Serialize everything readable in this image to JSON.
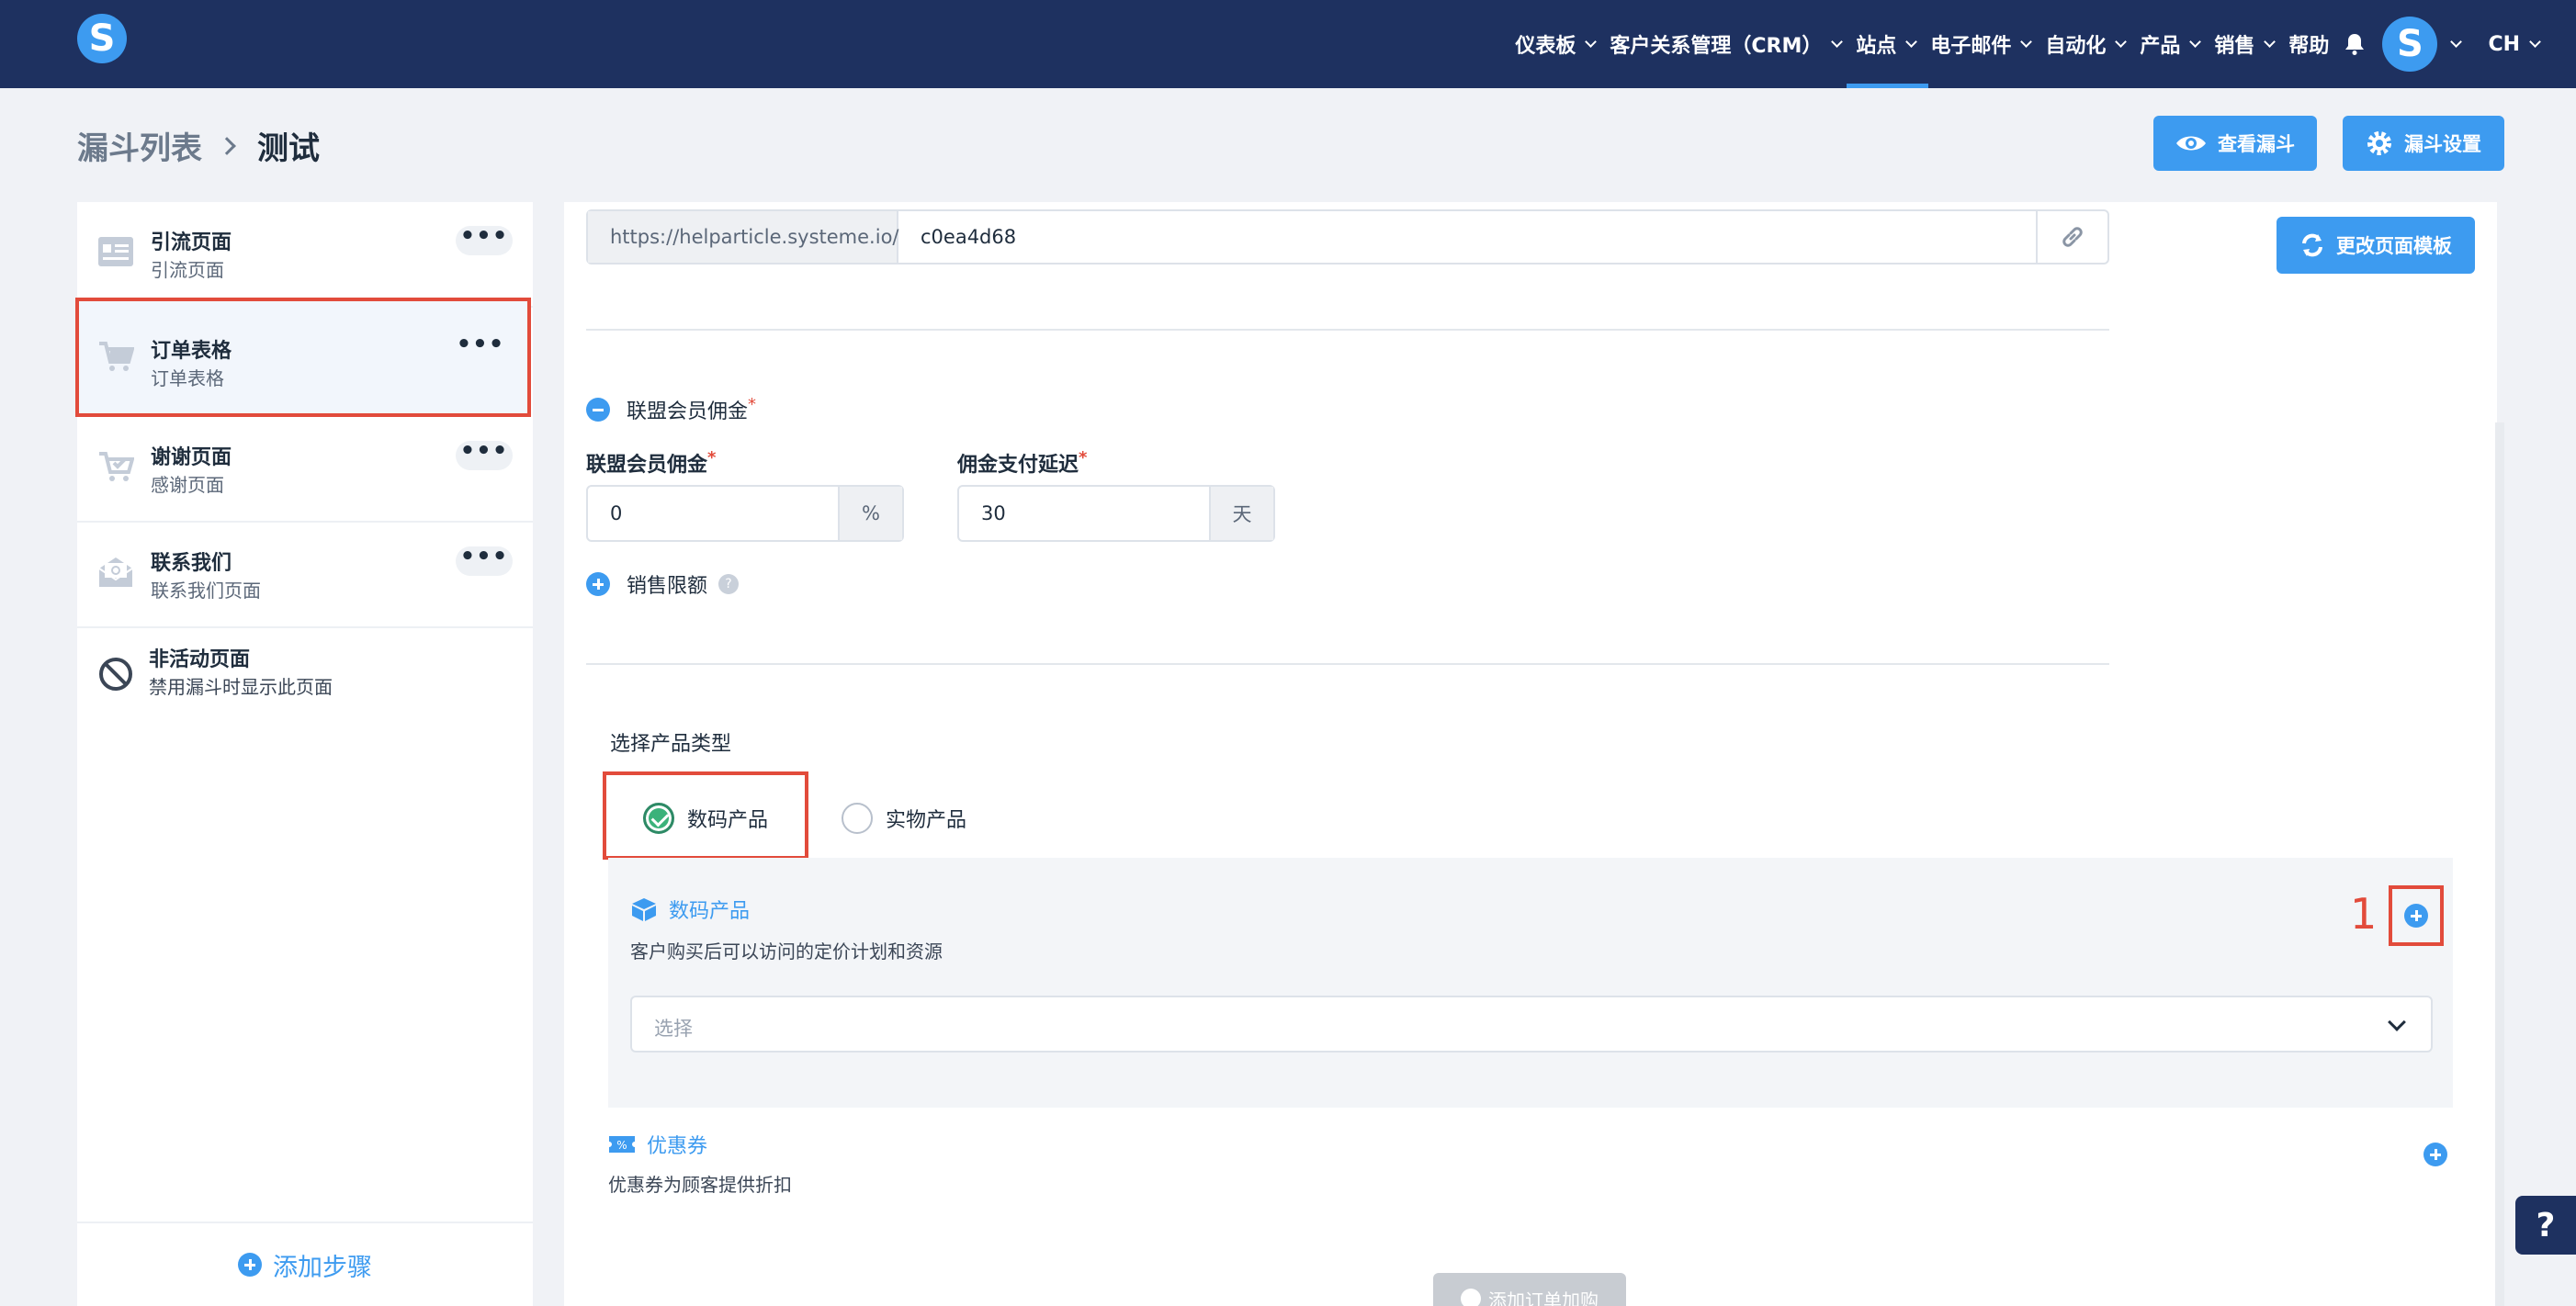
{
  "nav": {
    "items": [
      {
        "label": "仪表板",
        "dropdown": true
      },
      {
        "label": "客户关系管理（CRM）",
        "dropdown": true
      },
      {
        "label": "站点",
        "dropdown": true,
        "active": true
      },
      {
        "label": "电子邮件",
        "dropdown": true
      },
      {
        "label": "自动化",
        "dropdown": true
      },
      {
        "label": "产品",
        "dropdown": true
      },
      {
        "label": "销售",
        "dropdown": true
      },
      {
        "label": "帮助",
        "dropdown": false
      }
    ],
    "logo_letter": "S",
    "avatar_letter": "S",
    "lang": "CH"
  },
  "breadcrumb": {
    "parent": "漏斗列表",
    "current": "测试"
  },
  "header_buttons": {
    "view_funnel": "查看漏斗",
    "funnel_settings": "漏斗设置"
  },
  "steps": [
    {
      "title": "引流页面",
      "subtitle": "引流页面",
      "icon": "page-icon",
      "more": "•••"
    },
    {
      "title": "订单表格",
      "subtitle": "订单表格",
      "icon": "cart-icon",
      "more": "•••",
      "selected": true
    },
    {
      "title": "谢谢页面",
      "subtitle": "感谢页面",
      "icon": "cart-check-icon",
      "more": "•••"
    },
    {
      "title": "联系我们",
      "subtitle": "联系我们页面",
      "icon": "mail-icon",
      "more": "•••"
    },
    {
      "title": "非活动页面",
      "subtitle": "禁用漏斗时显示此页面",
      "icon": "disabled-icon"
    }
  ],
  "add_step": "添加步骤",
  "main": {
    "url_prefix": "https://helparticle.systeme.io/",
    "url_value": "c0ea4d68",
    "change_template": "更改页面模板",
    "affiliate": {
      "section": "联盟会员佣金",
      "commission_label": "联盟会员佣金",
      "commission_value": "0",
      "commission_unit": "%",
      "delay_label": "佣金支付延迟",
      "delay_value": "30",
      "delay_unit": "天"
    },
    "sales_limit": "销售限额",
    "product_type_title": "选择产品类型",
    "product_types": [
      "数码产品",
      "实物产品"
    ],
    "digital": {
      "title": "数码产品",
      "description": "客户购买后可以访问的定价计划和资源",
      "annotation": "1",
      "select_placeholder": "选择"
    },
    "coupon": {
      "title": "优惠券",
      "description": "优惠券为顾客提供折扣"
    },
    "add_bump": "添加订单加购"
  },
  "help_fab": "?",
  "colors": {
    "navy": "#1e3160",
    "accent": "#3d9bf0",
    "highlight": "#e24b3b",
    "success": "#3bb27a"
  }
}
